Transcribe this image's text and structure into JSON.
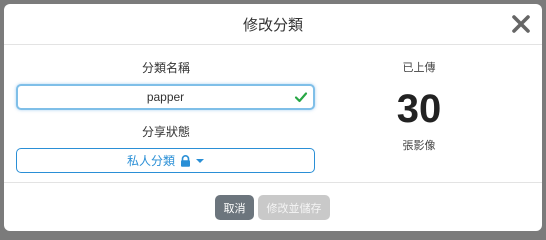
{
  "modal": {
    "title": "修改分類",
    "close_icon": "close-icon"
  },
  "form": {
    "name_label": "分類名稱",
    "name_value": "papper",
    "name_valid_icon": "check-icon",
    "share_label": "分享狀態",
    "share_value": "私人分類",
    "share_icons": [
      "lock-icon",
      "caret-down-icon"
    ]
  },
  "stats": {
    "uploaded_label": "已上傳",
    "count": "30",
    "count_unit": "張影像"
  },
  "footer": {
    "cancel_label": "取消",
    "save_label": "修改並儲存"
  },
  "colors": {
    "accent": "#2a8fd6",
    "valid": "#28a745",
    "cancel_button": "#6c757d",
    "save_button_disabled": "#c9c9c9"
  }
}
